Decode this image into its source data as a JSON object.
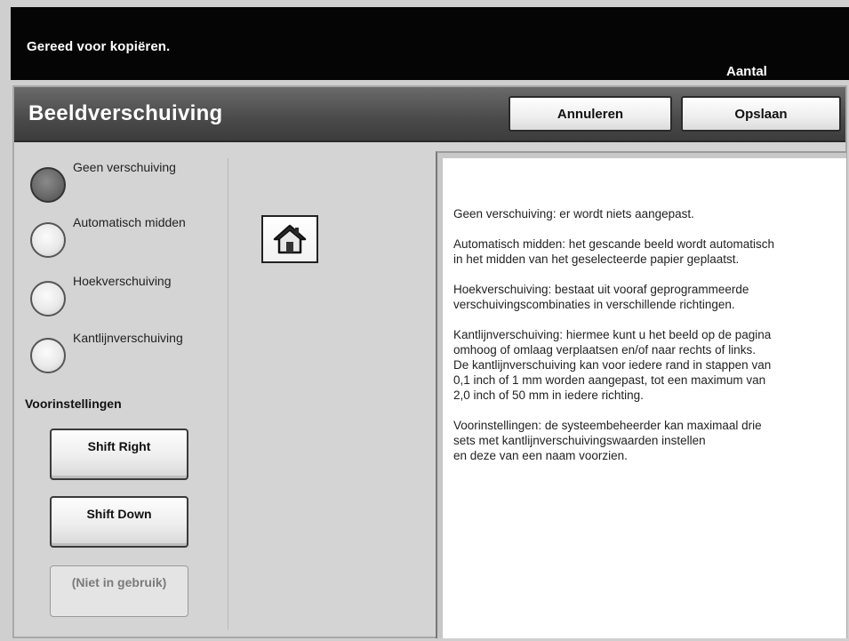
{
  "status": {
    "message": "Gereed voor kopiëren.",
    "quantity_label": "Aantal"
  },
  "header": {
    "title": "Beeldverschuiving",
    "cancel_label": "Annuleren",
    "save_label": "Opslaan"
  },
  "shift_options": [
    {
      "label": "Geen verschuiving",
      "selected": true
    },
    {
      "label": "Automatisch midden",
      "selected": false
    },
    {
      "label": "Hoekverschuiving",
      "selected": false
    },
    {
      "label": "Kantlijnverschuiving",
      "selected": false
    }
  ],
  "presets": {
    "label": "Voorinstellingen",
    "items": [
      {
        "label": "Shift Right",
        "enabled": true
      },
      {
        "label": "Shift Down",
        "enabled": true
      },
      {
        "label": "(Niet in gebruik)",
        "enabled": false
      }
    ]
  },
  "home_button": {
    "icon": "home-icon"
  },
  "description": {
    "paragraphs": [
      "Geen verschuiving: er wordt niets aangepast.",
      "Automatisch midden: het gescande beeld wordt automatisch\nin het midden van het geselecteerde papier geplaatst.",
      "Hoekverschuiving: bestaat uit vooraf geprogrammeerde\nverschuivingscombinaties in verschillende richtingen.",
      "Kantlijnverschuiving: hiermee kunt u het beeld op de pagina\nomhoog of omlaag verplaatsen en/of naar rechts of links.\nDe kantlijnverschuiving kan voor iedere rand in stappen van\n0,1 inch of 1 mm worden aangepast, tot een maximum van\n2,0 inch of 50 mm in iedere richting.",
      "Voorinstellingen: de systeembeheerder kan maximaal drie\nsets met kantlijnverschuivingswaarden instellen\nen deze van een naam voorzien."
    ]
  },
  "colors": {
    "status_bar": "#050505",
    "title_bar": "#4a4a4a",
    "background": "#d4d4d4",
    "selected_radio": "#6a6a6a"
  }
}
